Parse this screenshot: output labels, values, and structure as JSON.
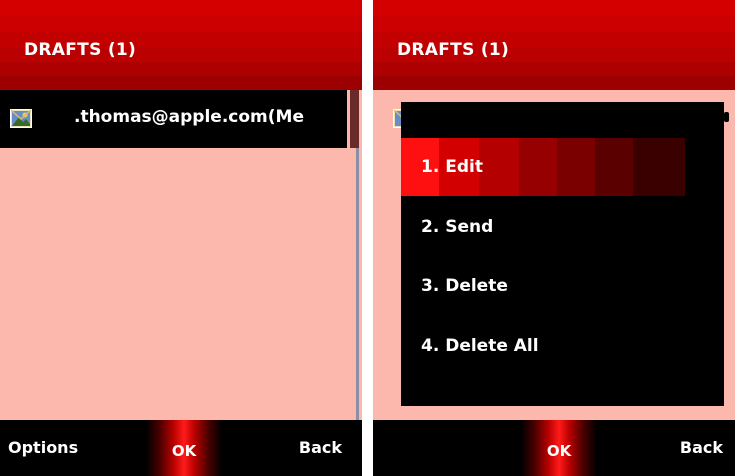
{
  "screens": [
    {
      "title": "DRAFTS (1)",
      "list": [
        {
          "text": ".thomas@apple.com(Me",
          "icon": "envelope-photo-icon"
        }
      ],
      "softkeys": {
        "left": "Options",
        "center": "OK",
        "right": "Back"
      }
    },
    {
      "title": "DRAFTS (1)",
      "menu": {
        "items": [
          {
            "label": "1. Edit",
            "selected": true
          },
          {
            "label": "2. Send",
            "selected": false
          },
          {
            "label": "3. Delete",
            "selected": false
          },
          {
            "label": "4. Delete All",
            "selected": false
          }
        ]
      },
      "softkeys": {
        "left": "",
        "center": "OK",
        "right": "Back"
      }
    }
  ],
  "colors": {
    "screen_background": "#fdb8ae",
    "title_bar": "#c30000",
    "highlight": "#ff1010",
    "text": "#ffffff"
  }
}
